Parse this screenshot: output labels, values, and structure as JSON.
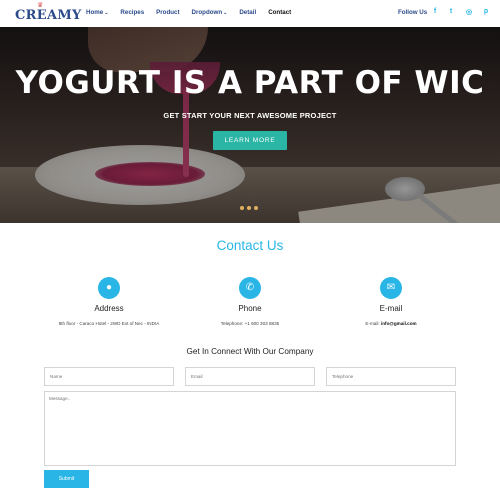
{
  "brand": {
    "name": "CREAMY",
    "crown": "♛"
  },
  "nav": {
    "items": [
      {
        "label": "Home",
        "caret": "⌄",
        "active": false
      },
      {
        "label": "Recipes",
        "caret": "",
        "active": false
      },
      {
        "label": "Product",
        "caret": "",
        "active": false
      },
      {
        "label": "Dropdown",
        "caret": "⌄",
        "active": false
      },
      {
        "label": "Detail",
        "caret": "",
        "active": false
      },
      {
        "label": "Contact",
        "caret": "",
        "active": true
      }
    ],
    "follow_label": "Follow Us",
    "social": [
      {
        "icon": "facebook-icon",
        "glyph": "f"
      },
      {
        "icon": "twitter-icon",
        "glyph": "t"
      },
      {
        "icon": "instagram-icon",
        "glyph": "◎"
      },
      {
        "icon": "pinterest-icon",
        "glyph": "p"
      }
    ]
  },
  "hero": {
    "title": "YOGURT IS A PART OF WIC",
    "subtitle": "GET START YOUR NEXT AWESOME PROJECT",
    "button_label": "LEARN MORE",
    "slide_count": 3
  },
  "contact": {
    "title": "Contact Us",
    "info": [
      {
        "icon": "location-icon",
        "glyph": "●",
        "label": "Address",
        "text": "8th floor - Caraco Hotel - 2WD Ext of Nec - INDIA",
        "prefix": ""
      },
      {
        "icon": "phone-icon",
        "glyph": "✆",
        "label": "Phone",
        "text": "+1 600 303 8835",
        "prefix": "Telephone: "
      },
      {
        "icon": "email-icon",
        "glyph": "✉",
        "label": "E-mail",
        "text": "info@gmail.com",
        "prefix": "E-mail: "
      }
    ],
    "connect_title": "Get In Connect With Our Company",
    "form": {
      "name_placeholder": "Name",
      "email_placeholder": "Email",
      "telephone_placeholder": "Telephone",
      "message_placeholder": "Message..",
      "submit_label": "Submit"
    }
  },
  "colors": {
    "accent": "#29b6e6",
    "button": "#2ab5a5",
    "brand": "#2a4a8a"
  }
}
